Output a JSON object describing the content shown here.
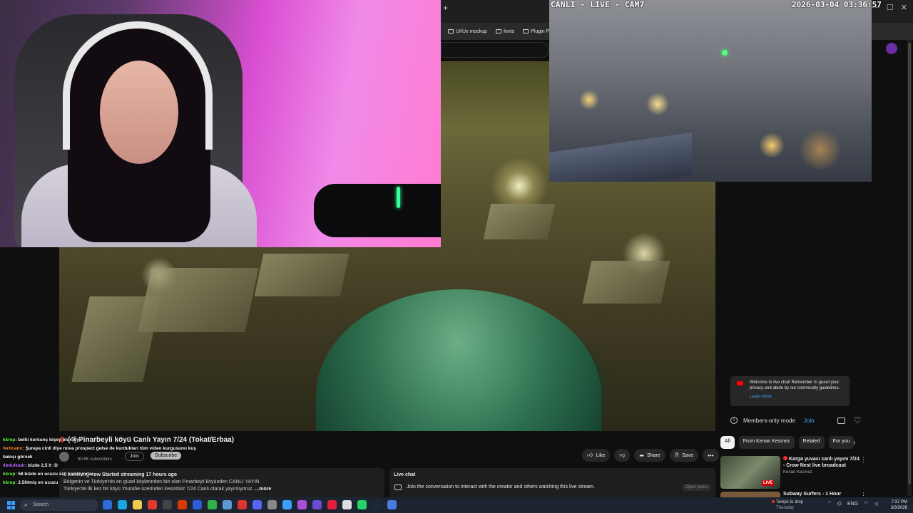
{
  "browser": {
    "bookmarks": [
      "UI/Ux mockup",
      "fonts",
      "Plugin Package"
    ]
  },
  "cam7": {
    "label": "CANLI - LIVE - CAM7",
    "timestamp": "2026-03-04 03:36:57"
  },
  "video": {
    "title": "(4) Pinarbeyli köyü Canlı Yayın 7/24 (Tokat/Erbaa)",
    "subscribers": "50.5K subscribers",
    "join_label": "Join",
    "subscribe_label": "Subscribe",
    "stats": "2 watching now  Started streaming 17 hours ago",
    "description_line1": "Bölgenin ve Türkiye'nin en güzel köylerinden biri olan Pınarbeyli köyünden CANLI YAYIN",
    "description_line2": "Türkiye'de ilk kez bir köyü Youtube üzerinden kesintisiz 7/24 Canlı olarak yayınlıyoruz.",
    "more_label": "...more",
    "actions": {
      "like": "Like",
      "share": "Share",
      "save": "Save"
    }
  },
  "live_chat_panel": {
    "header": "Live chat",
    "prompt": "Join the conversation to interact with the creator and others watching this live stream.",
    "open_label": "Open panel"
  },
  "chat_sidebar": {
    "welcome": "Welcome to live chat! Remember to guard your privacy and abide by our community guidelines.",
    "learn_more": "Learn more",
    "members_mode": "Members-only mode",
    "join": "Join"
  },
  "recommendations": {
    "chips": [
      "All",
      "From Kenan Kesmez",
      "Related",
      "For you"
    ],
    "items": [
      {
        "title": "Karga yuvası canlı yayını 7/24 - Crow Nest live broadcast",
        "channel": "Kenan Kesmez",
        "badge": "LIVE"
      },
      {
        "title": "Subway Surfers - 1 Hour"
      }
    ]
  },
  "stream_chat": [
    {
      "user": "kkrep",
      "text": "belki korkunç bişey olur diye",
      "color": "#6bff4a"
    },
    {
      "user": "feritcann",
      "text": "Şuraya cinli diye nova prospect gelse de kurdukları tüm video kurgusunu kuş bakışı görsek",
      "color": "#ff8f3a"
    },
    {
      "user": "4bdulkadr",
      "text": "bizde 2,5 lt :D",
      "color": "#c46bff"
    },
    {
      "user": "kkrep",
      "text": "58 bizde en ucuzu sizi kazıkıyorlar",
      "color": "#6bff4a"
    },
    {
      "user": "kkrep",
      "text": "2.5litmiş en ucuzu",
      "color": "#6bff4a"
    }
  ],
  "taskbar": {
    "search_placeholder": "Search",
    "weather_title": "Temps to drop",
    "weather_sub": "Thursday",
    "lang": "ENG",
    "time": "7:37 PM",
    "date": "3/3/2026"
  }
}
